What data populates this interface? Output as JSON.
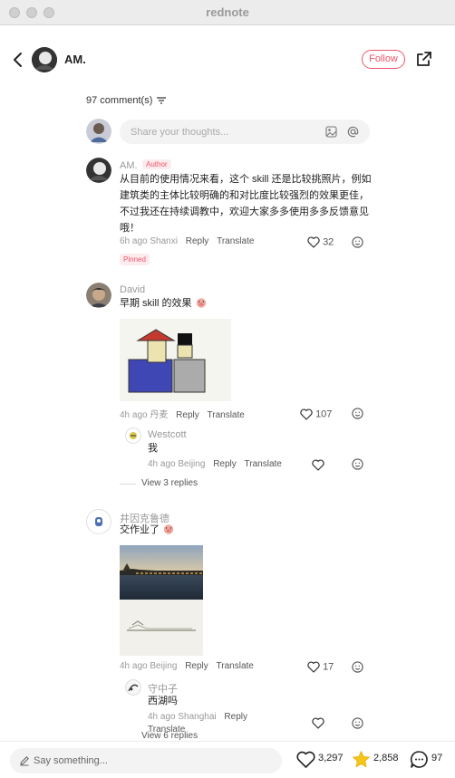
{
  "window": {
    "title": "rednote"
  },
  "header": {
    "author_name": "AM.",
    "follow_label": "Follow"
  },
  "comments_header": {
    "count_label": "97 comment(s)"
  },
  "composer": {
    "placeholder": "Share your thoughts..."
  },
  "comments": [
    {
      "name": "AM.",
      "badge": "Author",
      "text": "从目前的使用情况来看，这个 skill 还是比较挑照片，例如建筑类的主体比较明确的和对比度比较强烈的效果更佳，不过我还在持续调教中，欢迎大家多多使用多多反馈意见哦！",
      "time": "6h ago",
      "location": "Shanxi",
      "reply_label": "Reply",
      "translate_label": "Translate",
      "likes": "32",
      "pinned_label": "Pinned"
    },
    {
      "name": "David",
      "text": "早期 skill 的效果",
      "time": "4h ago",
      "location": "丹麦",
      "reply_label": "Reply",
      "translate_label": "Translate",
      "likes": "107",
      "reply": {
        "name": "Westcott",
        "text": "我",
        "time": "4h ago",
        "location": "Beijing",
        "reply_label": "Reply",
        "translate_label": "Translate"
      },
      "view_replies": "View 3 replies"
    },
    {
      "name": "井因克鲁德",
      "text": "交作业了",
      "time": "4h ago",
      "location": "Beijing",
      "reply_label": "Reply",
      "translate_label": "Translate",
      "likes": "17",
      "reply": {
        "name": "守中子",
        "text": "西湖吗",
        "time": "4h ago",
        "location": "Shanghai",
        "reply_label": "Reply",
        "translate_label": "Translate"
      },
      "view_replies": "View 6 replies"
    }
  ],
  "bottom_bar": {
    "placeholder": "Say something...",
    "likes": "3,297",
    "stars": "2,858",
    "comments": "97"
  },
  "colors": {
    "accent": "#f0556b",
    "star": "#f5c518"
  }
}
